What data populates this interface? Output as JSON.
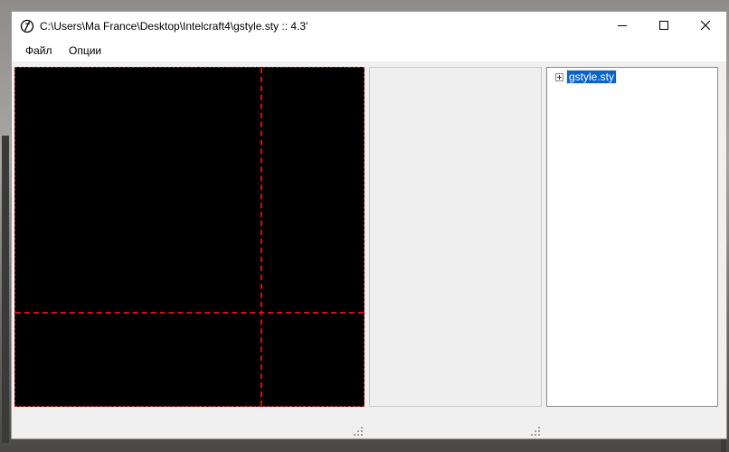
{
  "window": {
    "title": "C:\\Users\\Ma France\\Desktop\\Intelcraft4\\gstyle.sty :: 4.3'",
    "icon": "app-logo-icon",
    "controls": [
      "minimize-icon",
      "maximize-icon",
      "close-icon"
    ]
  },
  "menu": {
    "file": "Файл",
    "options": "Опции"
  },
  "canvas": {
    "background": "#000000",
    "guide_color": "#d01010"
  },
  "tree": {
    "root_label": "gstyle.sty",
    "selected_color": "#0a63c8"
  }
}
